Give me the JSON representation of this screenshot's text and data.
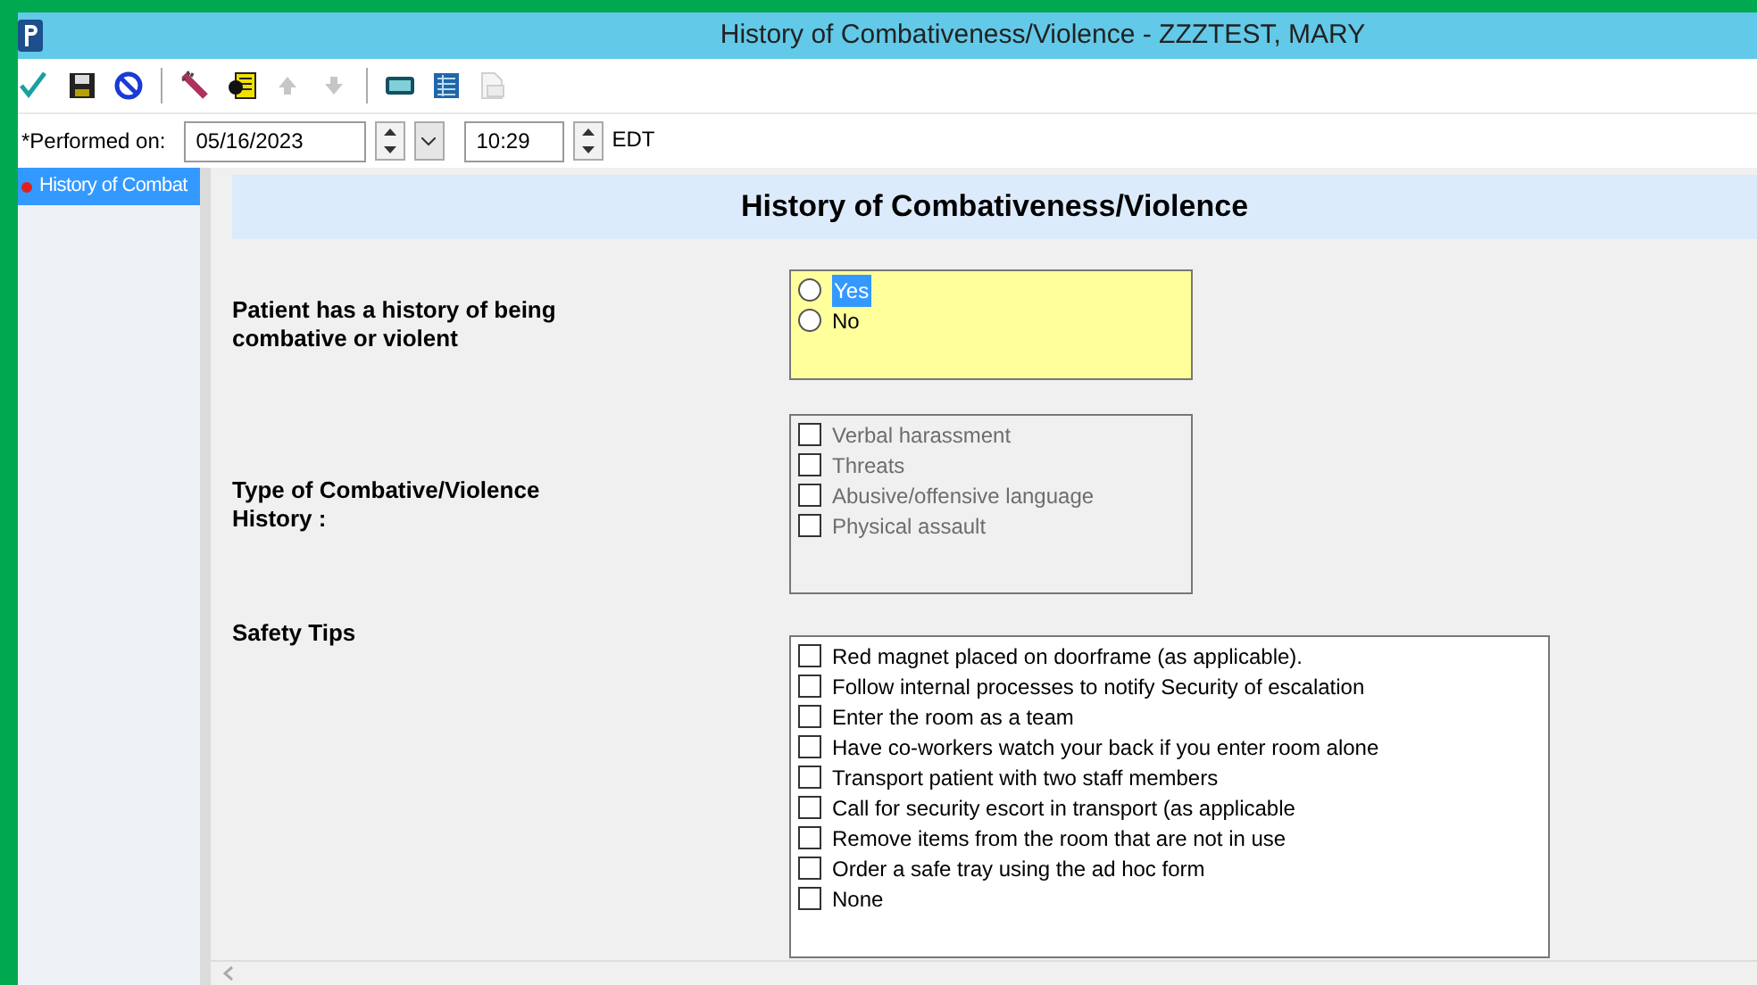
{
  "window": {
    "title": "History of Combativeness/Violence - ZZZTEST, MARY"
  },
  "toolbar": [
    {
      "kind": "sign",
      "disabled": false
    },
    {
      "kind": "save",
      "disabled": false
    },
    {
      "kind": "cancel",
      "disabled": false
    },
    {
      "kind": "separator"
    },
    {
      "kind": "wand",
      "disabled": false
    },
    {
      "kind": "person",
      "disabled": false
    },
    {
      "kind": "up",
      "disabled": true
    },
    {
      "kind": "down",
      "disabled": true
    },
    {
      "kind": "separator"
    },
    {
      "kind": "monitor",
      "disabled": false
    },
    {
      "kind": "grid",
      "disabled": false
    },
    {
      "kind": "print",
      "disabled": true
    }
  ],
  "performed_on": {
    "label": "*Performed on:",
    "date": "05/16/2023",
    "time": "10:29",
    "zone": "EDT"
  },
  "sidebar": {
    "items": [
      {
        "label": "History of Combat",
        "selected": true
      }
    ]
  },
  "form": {
    "title": "History of Combativeness/Violence",
    "sections": [
      {
        "label": "Patient has a history of being combative or violent",
        "kind": "radio",
        "required": true,
        "disabled": false,
        "options": [
          {
            "label": "Yes",
            "selected": false,
            "focused": true
          },
          {
            "label": "No",
            "selected": false,
            "focused": false
          }
        ]
      },
      {
        "label": "Type of Combative/Violence History :",
        "kind": "checkbox",
        "required": false,
        "disabled": true,
        "options": [
          {
            "label": "Verbal harassment",
            "checked": false
          },
          {
            "label": "Threats",
            "checked": false
          },
          {
            "label": "Abusive/offensive language",
            "checked": false
          },
          {
            "label": "Physical assault",
            "checked": false
          }
        ]
      },
      {
        "label": "Safety Tips",
        "kind": "checkbox",
        "required": false,
        "disabled": false,
        "options": [
          {
            "label": "Red magnet placed on doorframe (as applicable).",
            "checked": false
          },
          {
            "label": "Follow internal processes to notify Security of escalation",
            "checked": false
          },
          {
            "label": "Enter the room as a team",
            "checked": false
          },
          {
            "label": "Have co-workers watch your back if you enter room alone",
            "checked": false
          },
          {
            "label": "Transport patient with two staff members",
            "checked": false
          },
          {
            "label": "Call for security escort in transport (as applicable",
            "checked": false
          },
          {
            "label": "Remove items from the room that are not in use",
            "checked": false
          },
          {
            "label": "Order a safe tray using the ad hoc form",
            "checked": false
          },
          {
            "label": "None",
            "checked": false
          }
        ]
      }
    ]
  }
}
